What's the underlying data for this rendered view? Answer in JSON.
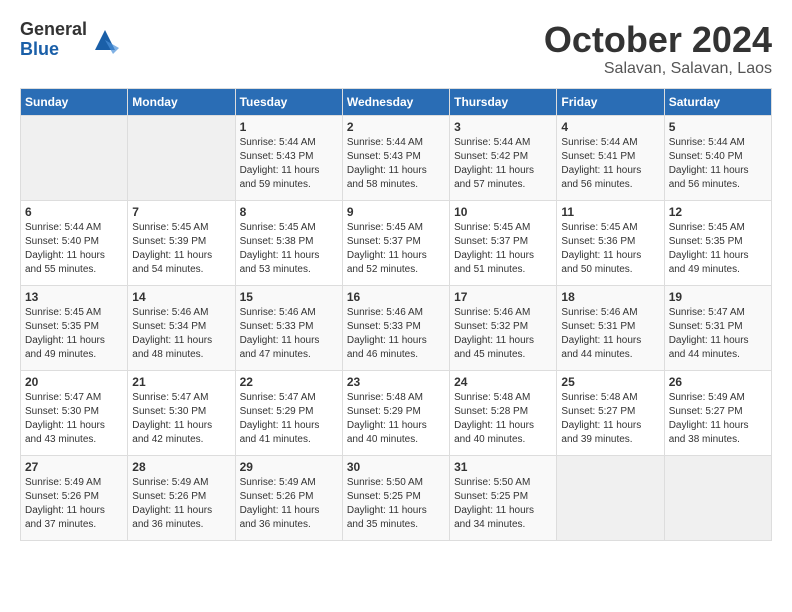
{
  "logo": {
    "general": "General",
    "blue": "Blue"
  },
  "title": "October 2024",
  "location": "Salavan, Salavan, Laos",
  "headers": [
    "Sunday",
    "Monday",
    "Tuesday",
    "Wednesday",
    "Thursday",
    "Friday",
    "Saturday"
  ],
  "weeks": [
    [
      {
        "day": "",
        "info": ""
      },
      {
        "day": "",
        "info": ""
      },
      {
        "day": "1",
        "info": "Sunrise: 5:44 AM\nSunset: 5:43 PM\nDaylight: 11 hours and 59 minutes."
      },
      {
        "day": "2",
        "info": "Sunrise: 5:44 AM\nSunset: 5:43 PM\nDaylight: 11 hours and 58 minutes."
      },
      {
        "day": "3",
        "info": "Sunrise: 5:44 AM\nSunset: 5:42 PM\nDaylight: 11 hours and 57 minutes."
      },
      {
        "day": "4",
        "info": "Sunrise: 5:44 AM\nSunset: 5:41 PM\nDaylight: 11 hours and 56 minutes."
      },
      {
        "day": "5",
        "info": "Sunrise: 5:44 AM\nSunset: 5:40 PM\nDaylight: 11 hours and 56 minutes."
      }
    ],
    [
      {
        "day": "6",
        "info": "Sunrise: 5:44 AM\nSunset: 5:40 PM\nDaylight: 11 hours and 55 minutes."
      },
      {
        "day": "7",
        "info": "Sunrise: 5:45 AM\nSunset: 5:39 PM\nDaylight: 11 hours and 54 minutes."
      },
      {
        "day": "8",
        "info": "Sunrise: 5:45 AM\nSunset: 5:38 PM\nDaylight: 11 hours and 53 minutes."
      },
      {
        "day": "9",
        "info": "Sunrise: 5:45 AM\nSunset: 5:37 PM\nDaylight: 11 hours and 52 minutes."
      },
      {
        "day": "10",
        "info": "Sunrise: 5:45 AM\nSunset: 5:37 PM\nDaylight: 11 hours and 51 minutes."
      },
      {
        "day": "11",
        "info": "Sunrise: 5:45 AM\nSunset: 5:36 PM\nDaylight: 11 hours and 50 minutes."
      },
      {
        "day": "12",
        "info": "Sunrise: 5:45 AM\nSunset: 5:35 PM\nDaylight: 11 hours and 49 minutes."
      }
    ],
    [
      {
        "day": "13",
        "info": "Sunrise: 5:45 AM\nSunset: 5:35 PM\nDaylight: 11 hours and 49 minutes."
      },
      {
        "day": "14",
        "info": "Sunrise: 5:46 AM\nSunset: 5:34 PM\nDaylight: 11 hours and 48 minutes."
      },
      {
        "day": "15",
        "info": "Sunrise: 5:46 AM\nSunset: 5:33 PM\nDaylight: 11 hours and 47 minutes."
      },
      {
        "day": "16",
        "info": "Sunrise: 5:46 AM\nSunset: 5:33 PM\nDaylight: 11 hours and 46 minutes."
      },
      {
        "day": "17",
        "info": "Sunrise: 5:46 AM\nSunset: 5:32 PM\nDaylight: 11 hours and 45 minutes."
      },
      {
        "day": "18",
        "info": "Sunrise: 5:46 AM\nSunset: 5:31 PM\nDaylight: 11 hours and 44 minutes."
      },
      {
        "day": "19",
        "info": "Sunrise: 5:47 AM\nSunset: 5:31 PM\nDaylight: 11 hours and 44 minutes."
      }
    ],
    [
      {
        "day": "20",
        "info": "Sunrise: 5:47 AM\nSunset: 5:30 PM\nDaylight: 11 hours and 43 minutes."
      },
      {
        "day": "21",
        "info": "Sunrise: 5:47 AM\nSunset: 5:30 PM\nDaylight: 11 hours and 42 minutes."
      },
      {
        "day": "22",
        "info": "Sunrise: 5:47 AM\nSunset: 5:29 PM\nDaylight: 11 hours and 41 minutes."
      },
      {
        "day": "23",
        "info": "Sunrise: 5:48 AM\nSunset: 5:29 PM\nDaylight: 11 hours and 40 minutes."
      },
      {
        "day": "24",
        "info": "Sunrise: 5:48 AM\nSunset: 5:28 PM\nDaylight: 11 hours and 40 minutes."
      },
      {
        "day": "25",
        "info": "Sunrise: 5:48 AM\nSunset: 5:27 PM\nDaylight: 11 hours and 39 minutes."
      },
      {
        "day": "26",
        "info": "Sunrise: 5:49 AM\nSunset: 5:27 PM\nDaylight: 11 hours and 38 minutes."
      }
    ],
    [
      {
        "day": "27",
        "info": "Sunrise: 5:49 AM\nSunset: 5:26 PM\nDaylight: 11 hours and 37 minutes."
      },
      {
        "day": "28",
        "info": "Sunrise: 5:49 AM\nSunset: 5:26 PM\nDaylight: 11 hours and 36 minutes."
      },
      {
        "day": "29",
        "info": "Sunrise: 5:49 AM\nSunset: 5:26 PM\nDaylight: 11 hours and 36 minutes."
      },
      {
        "day": "30",
        "info": "Sunrise: 5:50 AM\nSunset: 5:25 PM\nDaylight: 11 hours and 35 minutes."
      },
      {
        "day": "31",
        "info": "Sunrise: 5:50 AM\nSunset: 5:25 PM\nDaylight: 11 hours and 34 minutes."
      },
      {
        "day": "",
        "info": ""
      },
      {
        "day": "",
        "info": ""
      }
    ]
  ]
}
